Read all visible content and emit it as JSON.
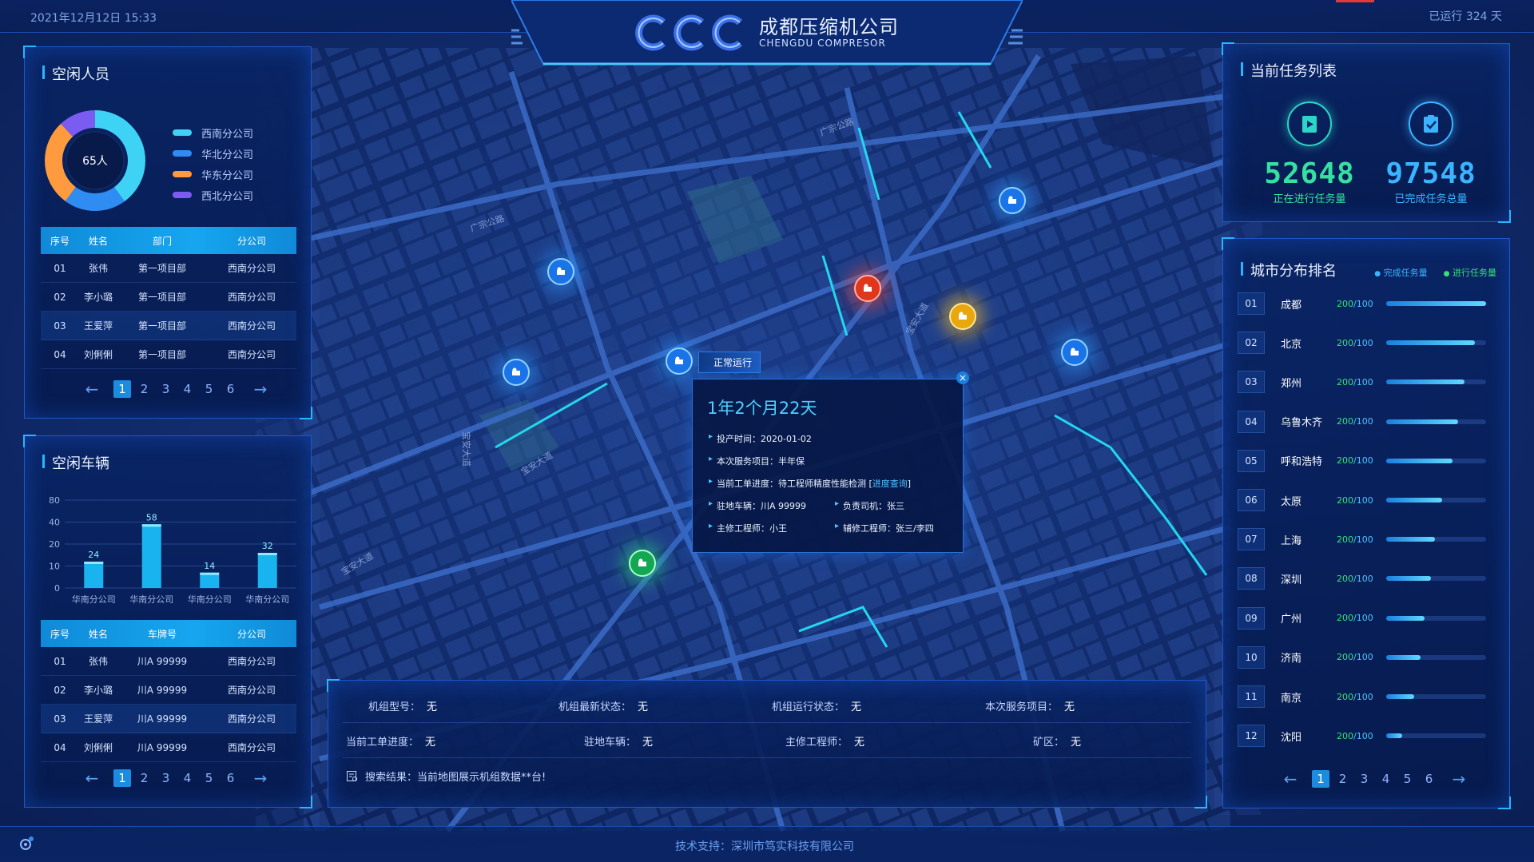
{
  "header": {
    "datetime": "2021年12月12日 15:33",
    "runtime": "已运行 324 天",
    "company_cn": "成都压缩机公司",
    "company_en": "CHENGDU COMPRESOR"
  },
  "idle_staff": {
    "title": "空闲人员",
    "total": "65人",
    "legend": [
      {
        "label": "西南分公司",
        "color": "#3ed3f5",
        "value": 40
      },
      {
        "label": "华北分公司",
        "color": "#2f8cf2",
        "value": 20
      },
      {
        "label": "华东分公司",
        "color": "#ff9a3e",
        "value": 28
      },
      {
        "label": "西北分公司",
        "color": "#7b5cf3",
        "value": 12
      }
    ],
    "columns": [
      "序号",
      "姓名",
      "部门",
      "分公司"
    ],
    "rows": [
      [
        "01",
        "张伟",
        "第一项目部",
        "西南分公司"
      ],
      [
        "02",
        "李小璐",
        "第一项目部",
        "西南分公司"
      ],
      [
        "03",
        "王爱萍",
        "第一项目部",
        "西南分公司"
      ],
      [
        "04",
        "刘俐俐",
        "第一项目部",
        "西南分公司"
      ]
    ],
    "pages": [
      "1",
      "2",
      "3",
      "4",
      "5",
      "6"
    ]
  },
  "idle_vehicles": {
    "title": "空闲车辆",
    "columns": [
      "序号",
      "姓名",
      "车牌号",
      "分公司"
    ],
    "rows": [
      [
        "01",
        "张伟",
        "川A 99999",
        "西南分公司"
      ],
      [
        "02",
        "李小璐",
        "川A 99999",
        "西南分公司"
      ],
      [
        "03",
        "王爱萍",
        "川A 99999",
        "西南分公司"
      ],
      [
        "04",
        "刘俐俐",
        "川A 99999",
        "西南分公司"
      ]
    ],
    "pages": [
      "1",
      "2",
      "3",
      "4",
      "5",
      "6"
    ]
  },
  "chart_data": {
    "type": "bar",
    "categories": [
      "华南分公司",
      "华南分公司",
      "华南分公司",
      "华南分公司"
    ],
    "values": [
      24,
      58,
      14,
      32
    ],
    "yticks": [
      "80",
      "40",
      "20",
      "10",
      "0"
    ],
    "title": "",
    "xlabel": "",
    "ylabel": ""
  },
  "tasks": {
    "title": "当前任务列表",
    "in_progress": {
      "value": "52648",
      "label": "正在进行任务量"
    },
    "completed": {
      "value": "97548",
      "label": "已完成任务总量"
    }
  },
  "ranking": {
    "title": "城市分布排名",
    "legend_completed": "完成任务量",
    "legend_progress": "进行任务量",
    "rows": [
      {
        "no": "01",
        "city": "成都",
        "a": "200",
        "b": "100",
        "ratio": 1.0
      },
      {
        "no": "02",
        "city": "北京",
        "a": "200",
        "b": "100",
        "ratio": 0.89
      },
      {
        "no": "03",
        "city": "郑州",
        "a": "200",
        "b": "100",
        "ratio": 0.78
      },
      {
        "no": "04",
        "city": "乌鲁木齐",
        "a": "200",
        "b": "100",
        "ratio": 0.72
      },
      {
        "no": "05",
        "city": "呼和浩特",
        "a": "200",
        "b": "100",
        "ratio": 0.66
      },
      {
        "no": "06",
        "city": "太原",
        "a": "200",
        "b": "100",
        "ratio": 0.56
      },
      {
        "no": "07",
        "city": "上海",
        "a": "200",
        "b": "100",
        "ratio": 0.49
      },
      {
        "no": "08",
        "city": "深圳",
        "a": "200",
        "b": "100",
        "ratio": 0.45
      },
      {
        "no": "09",
        "city": "广州",
        "a": "200",
        "b": "100",
        "ratio": 0.38
      },
      {
        "no": "10",
        "city": "济南",
        "a": "200",
        "b": "100",
        "ratio": 0.34
      },
      {
        "no": "11",
        "city": "南京",
        "a": "200",
        "b": "100",
        "ratio": 0.28
      },
      {
        "no": "12",
        "city": "沈阳",
        "a": "200",
        "b": "100",
        "ratio": 0.16
      }
    ],
    "pages": [
      "1",
      "2",
      "3",
      "4",
      "5",
      "6"
    ]
  },
  "popup": {
    "status": "正常运行",
    "duration": "1年2个月22天",
    "line1": "投产时间：2020-01-02",
    "line2": "本次服务项目：半年保",
    "line3_prefix": "当前工单进度：待工程师精度性能检测 [",
    "line3_link": "进度查询",
    "line3_suffix": "]",
    "vehicle": "驻地车辆：川A 99999",
    "driver": "负责司机：张三",
    "engineer": "主修工程师：小王",
    "assistant": "辅修工程师：张三/李四"
  },
  "bottom": {
    "model_label": "机组型号：",
    "model_value": "无",
    "latest_label": "机组最新状态：",
    "latest_value": "无",
    "run_label": "机组运行状态：",
    "run_value": "无",
    "service_label": "本次服务项目：",
    "service_value": "无",
    "progress_label": "当前工单进度：",
    "progress_value": "无",
    "vehicle_label": "驻地车辆：",
    "vehicle_value": "无",
    "engineer_label": "主修工程师：",
    "engineer_value": "无",
    "mine_label": "矿区：",
    "mine_value": "无",
    "search_result": "搜索结果：当前地图展示机组数据**台!"
  },
  "map_labels": {
    "road1": "广宗公路",
    "road2": "广宗公路",
    "road3": "宝安大道",
    "road4": "宝安大道",
    "road5": "宝安大道",
    "road6": "宝安大道"
  },
  "footer": {
    "support": "技术支持：深圳市笃实科技有限公司"
  }
}
